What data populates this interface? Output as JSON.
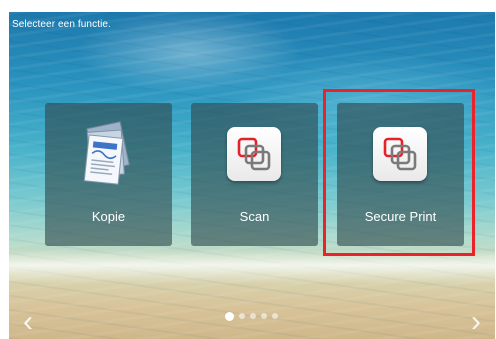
{
  "header": {
    "title": "Selecteer een functie."
  },
  "tiles": [
    {
      "label": "Kopie",
      "icon": "copy-documents-icon"
    },
    {
      "label": "Scan",
      "icon": "overlapping-squares-icon"
    },
    {
      "label": "Secure Print",
      "icon": "overlapping-squares-icon",
      "highlighted": true
    }
  ],
  "pager": {
    "pages": 5,
    "current": 1
  },
  "nav": {
    "prev": "‹",
    "next": "›"
  },
  "colors": {
    "highlight": "#e8242a",
    "tile_bg": "#2e484c",
    "icon_red": "#e2232a",
    "icon_gray": "#7a7a7a"
  }
}
